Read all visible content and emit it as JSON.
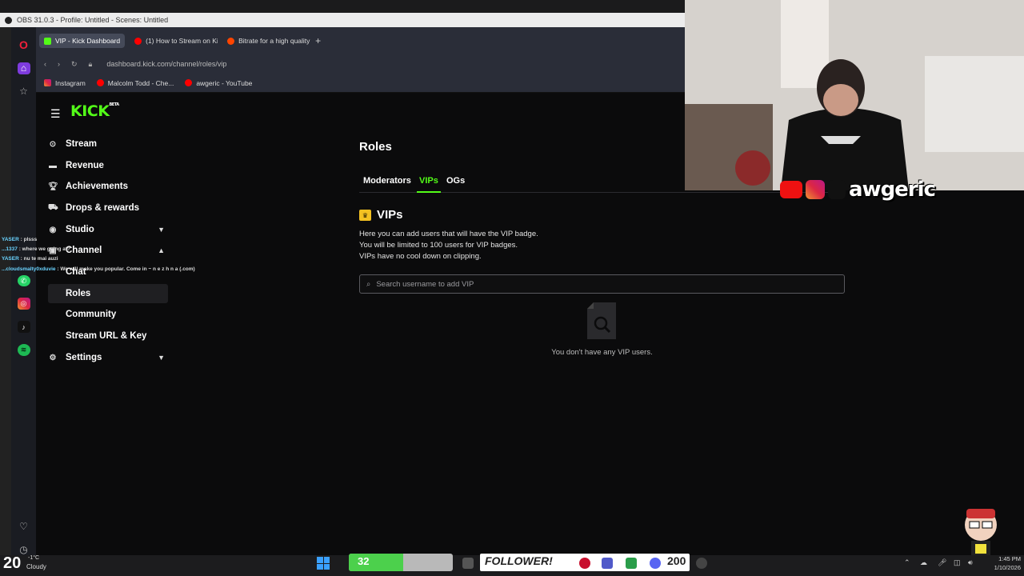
{
  "obs_title": "OBS 31.0.3 - Profile: Untitled - Scenes: Untitled",
  "browser": {
    "tabs": [
      {
        "label": "VIP - Kick Dashboard",
        "icon": "kick-icon"
      },
      {
        "label": "(1) How to Stream on Kick",
        "icon": "youtube-icon"
      },
      {
        "label": "Bitrate for a high quality st",
        "icon": "reddit-icon"
      }
    ],
    "new_tab": "+",
    "url": "dashboard.kick.com/channel/roles/vip",
    "bookmarks": [
      {
        "label": "Instagram",
        "icon": "instagram-icon"
      },
      {
        "label": "Malcolm Todd - Che...",
        "icon": "youtube-icon"
      },
      {
        "label": "awgeric - YouTube",
        "icon": "youtube-icon"
      }
    ]
  },
  "logo": {
    "text": "KICK",
    "beta": "BETA"
  },
  "sidebar": {
    "items": [
      {
        "label": "Stream",
        "icon": "stream-icon"
      },
      {
        "label": "Revenue",
        "icon": "revenue-icon"
      },
      {
        "label": "Achievements",
        "icon": "trophy-icon"
      },
      {
        "label": "Drops & rewards",
        "icon": "gift-icon"
      },
      {
        "label": "Studio",
        "icon": "studio-icon"
      },
      {
        "label": "Channel",
        "icon": "channel-icon"
      },
      {
        "label": "Settings",
        "icon": "gear-icon"
      }
    ],
    "channel_sub": [
      "Chat",
      "Roles",
      "Community",
      "Stream URL & Key"
    ]
  },
  "main": {
    "title": "Roles",
    "tabs": [
      "Moderators",
      "VIPs",
      "OGs"
    ],
    "active_tab": "VIPs",
    "section_title": "VIPs",
    "description": [
      "Here you can add users that will have the VIP badge.",
      "You will be limited to 100 users for VIP badges.",
      "VIPs have no cool down on clipping."
    ],
    "search_placeholder": "Search username to add VIP",
    "empty_text": "You don't have any VIP users."
  },
  "chat_overlay": [
    {
      "user": "YASER",
      "text": ": plsss"
    },
    {
      "user": "...1337",
      "text": ": where we going at?"
    },
    {
      "user": "YASER",
      "text": ": nu te mai auzi"
    },
    {
      "user": "...cloudsmalty0xduvie",
      "text": ": We will make you popular. Come in ~ n e z h n a (.com)"
    }
  ],
  "webcam": {
    "channel_name": "awgeric"
  },
  "taskbar": {
    "weather_temp": "20",
    "weather_deg": "-1°C",
    "weather_cond": "Cloudy",
    "counter_value": "32",
    "counter_progress": 0.52,
    "follower_label": "FOLLOWER!",
    "follower_count": "200",
    "time": "1:45 PM",
    "date": "1/10/2026"
  },
  "colors": {
    "accent": "#53fc18",
    "vip_badge": "#f3c121",
    "background": "#0b0b0c"
  }
}
